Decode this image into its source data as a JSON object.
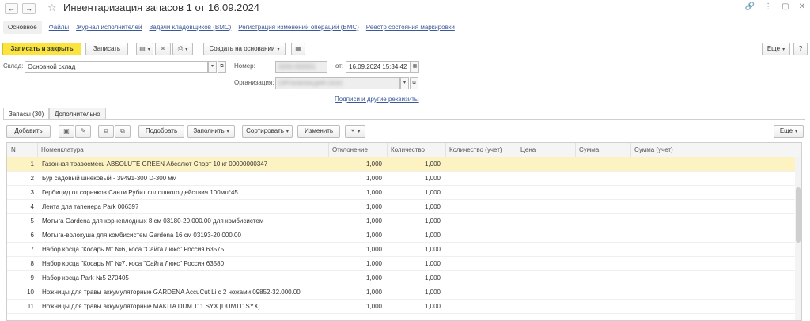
{
  "window": {
    "title": "Инвентаризация запасов 1 от 16.09.2024",
    "back": "←",
    "forward": "→",
    "star": "☆",
    "link_icon": "🔗",
    "more_icon": "⋮",
    "maximize_icon": "▢",
    "close_icon": "✕"
  },
  "topnav": [
    "Основное",
    "Файлы",
    "Журнал исполнителей",
    "Задачи кладовщиков (ВМС)",
    "Регистрация изменений операций (ВМС)",
    "Реестр состояния маркировки"
  ],
  "toolbar": {
    "save_close": "Записать и закрыть",
    "save": "Записать",
    "create_based": "Создать на основании",
    "more": "Еще"
  },
  "form": {
    "warehouse_label": "Склад:",
    "warehouse_value": "Основной склад",
    "number_label": "Номер:",
    "number_value": "0000-000001",
    "date_label": "от:",
    "date_value": "16.09.2024 15:34:42",
    "org_label": "Организация:",
    "org_value": "ОРГАНИЗАЦИЯ ООО",
    "signatures_link": "Подписи и другие реквизиты"
  },
  "tabs": [
    "Запасы (30)",
    "Дополнительно"
  ],
  "table_toolbar": {
    "add": "Добавить",
    "pick": "Подобрать",
    "fill": "Заполнить",
    "sort": "Сортировать",
    "change": "Изменить",
    "more": "Еще"
  },
  "table": {
    "columns": [
      "N",
      "Номенклатура",
      "Отклонение",
      "Количество",
      "Количество (учет)",
      "Цена",
      "Сумма",
      "Сумма (учет)"
    ],
    "rows": [
      [
        "1",
        "Газонная травосмесь ABSOLUTE GREEN Абсолют Спорт 10 кг 00000000347",
        "1,000",
        "1,000"
      ],
      [
        "2",
        "Бур садовый шнековый - 39491-300 D-300 мм",
        "1,000",
        "1,000"
      ],
      [
        "3",
        "Гербицид от сорняков Санти Рубит сплошного действия 100мл*45",
        "1,000",
        "1,000"
      ],
      [
        "4",
        "Лента для тапенера Park 006397",
        "1,000",
        "1,000"
      ],
      [
        "5",
        "Мотыга Gardena для корнеплодных 8 см 03180-20.000.00 для комбисистем",
        "1,000",
        "1,000"
      ],
      [
        "6",
        "Мотыга-волокуша для комбисистем Gardena 16 см 03193-20.000.00",
        "1,000",
        "1,000"
      ],
      [
        "7",
        "Набор косца \"Косарь М\" №6, коса \"Сайга Люкс\" Россия 63575",
        "1,000",
        "1,000"
      ],
      [
        "8",
        "Набор косца \"Косарь М\" №7, коса \"Сайга Люкс\" Россия 63580",
        "1,000",
        "1,000"
      ],
      [
        "9",
        "Набор косца Park №5 270405",
        "1,000",
        "1,000"
      ],
      [
        "10",
        "Ножницы для травы аккумуляторные GARDENA AccuCut Li с 2 ножами 09852-32.000.00",
        "1,000",
        "1,000"
      ],
      [
        "11",
        "Ножницы для травы аккумуляторные MAKITA DUM 111 SYX [DUM111SYX]",
        "1,000",
        "1,000"
      ]
    ]
  },
  "colors": {
    "primary_button": "#fbe43e",
    "selected_row": "#fdf3c2",
    "link": "#3b5998"
  }
}
